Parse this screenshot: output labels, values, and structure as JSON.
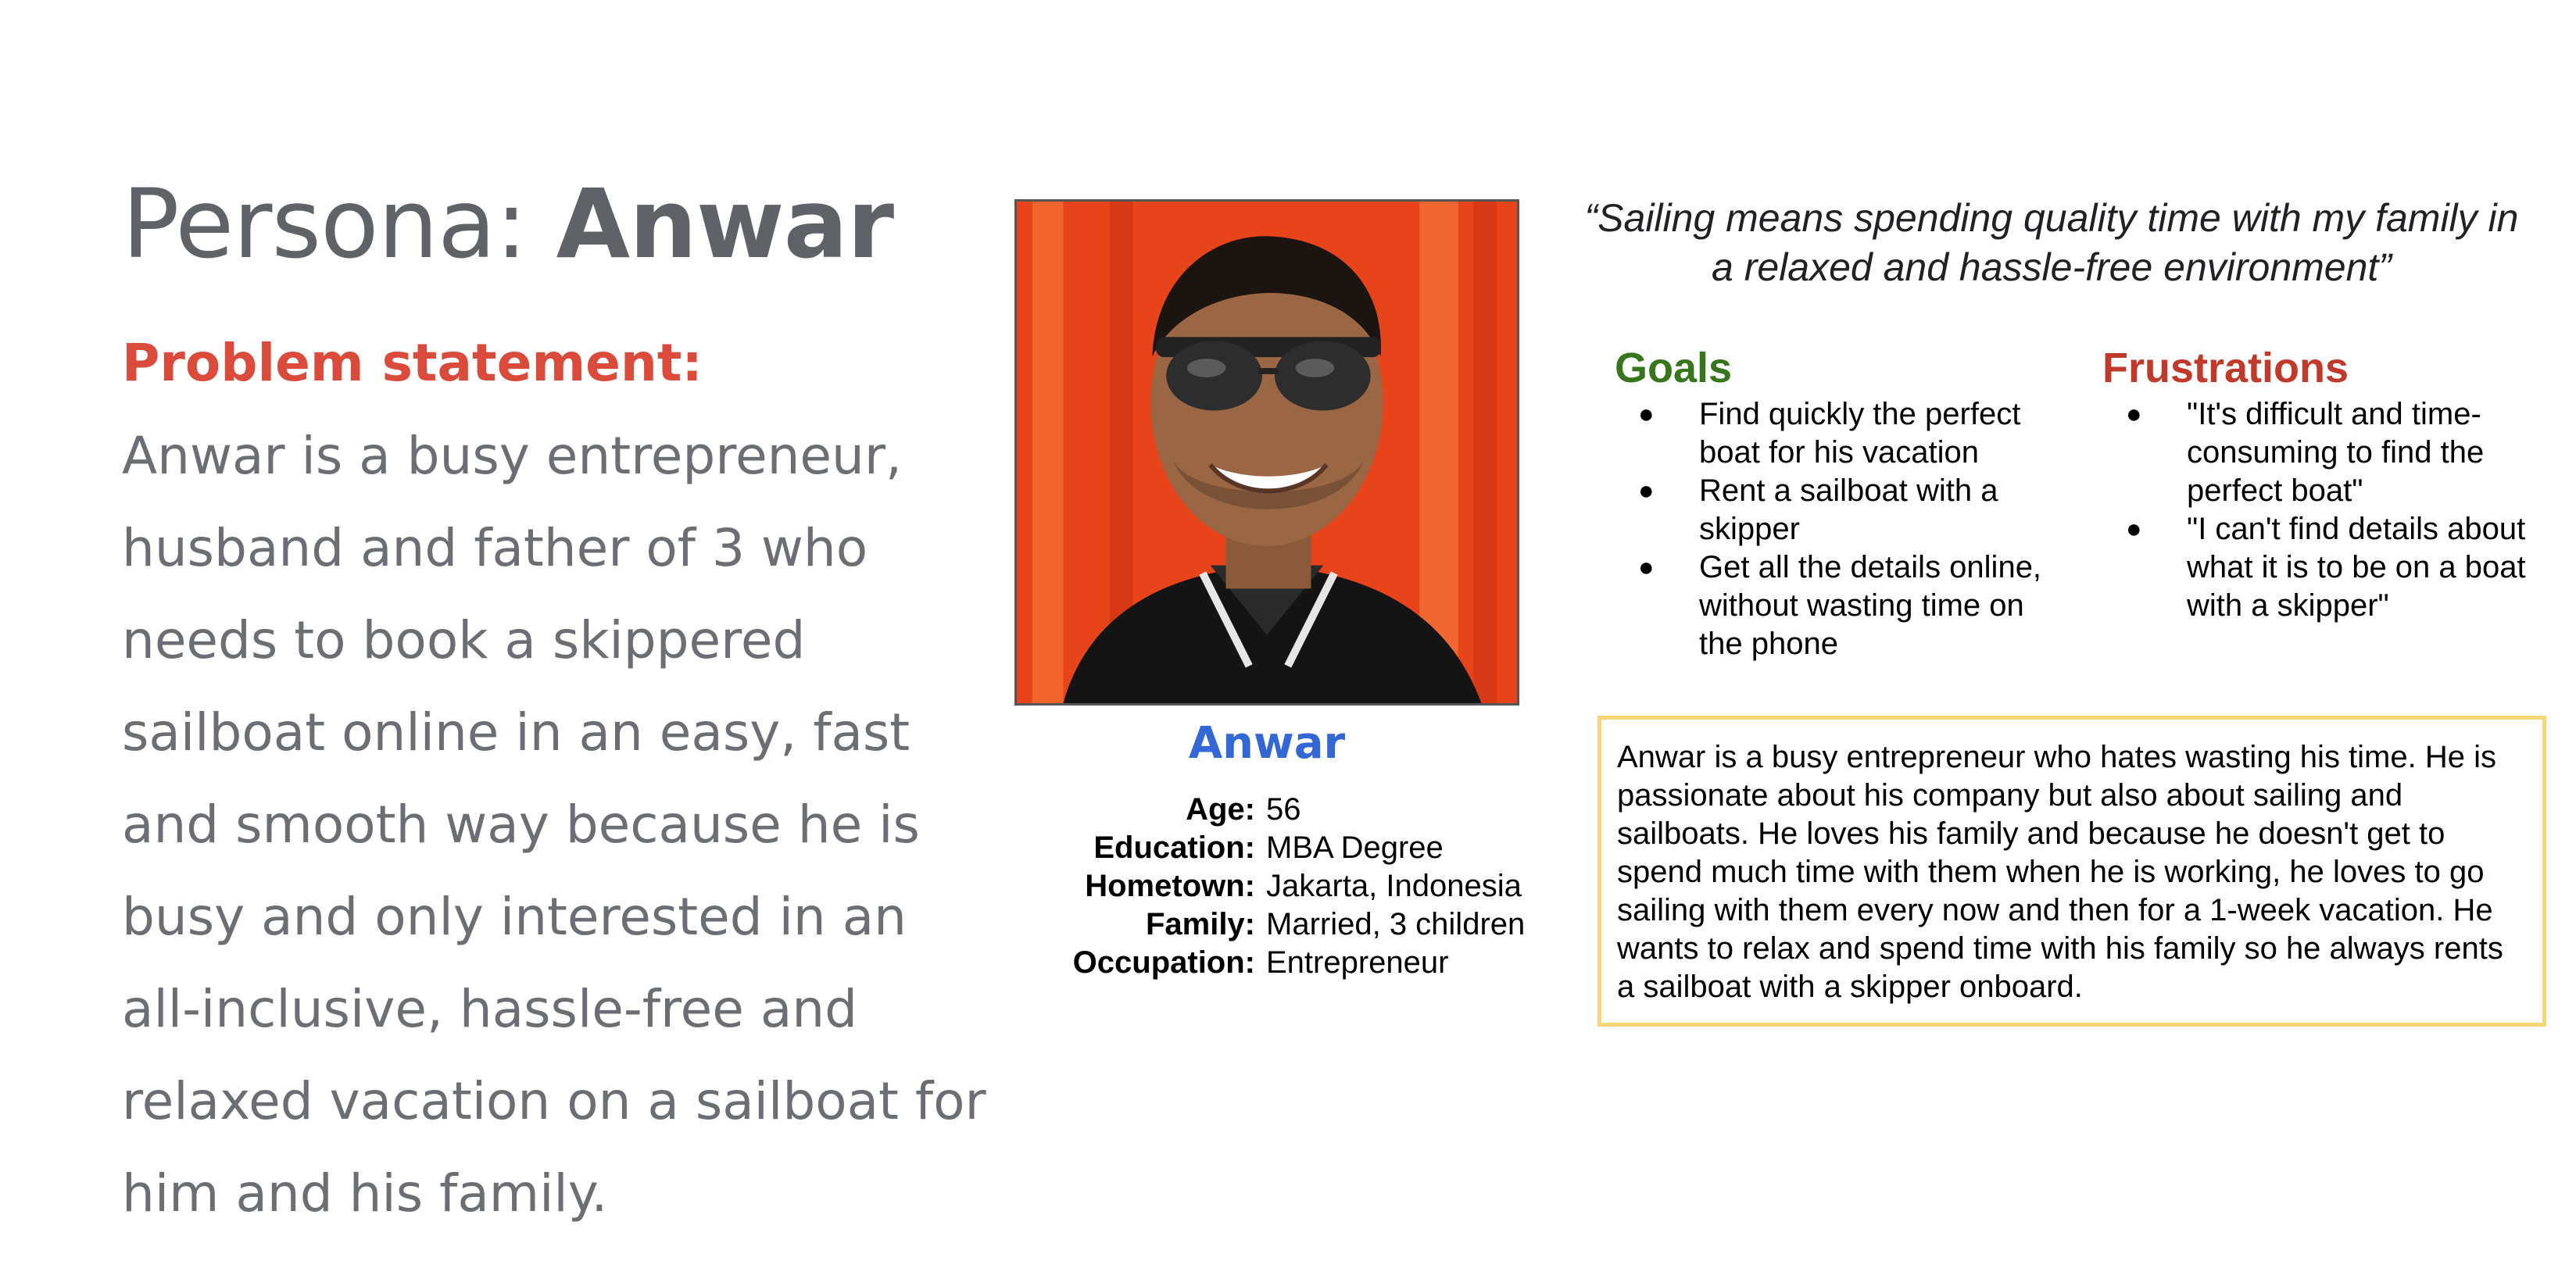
{
  "title": {
    "prefix": "Persona: ",
    "name": "Anwar"
  },
  "problem": {
    "heading": "Problem statement:",
    "text": "Anwar is a busy entrepreneur, husband and father of 3 who needs to book a skippered sailboat online in an easy, fast and smooth way because he is busy and only interested in an all-inclusive, hassle-free and relaxed vacation on a sailboat for him and his family."
  },
  "persona": {
    "name": "Anwar",
    "facts": [
      {
        "label": "Age:",
        "value": "56"
      },
      {
        "label": "Education:",
        "value": "MBA Degree"
      },
      {
        "label": "Hometown:",
        "value": "Jakarta, Indonesia"
      },
      {
        "label": "Family:",
        "value": "Married, 3 children"
      },
      {
        "label": "Occupation:",
        "value": "Entrepreneur"
      }
    ]
  },
  "quote": "“Sailing means spending quality time with my family in a relaxed and hassle-free environment”",
  "goals": {
    "heading": "Goals",
    "items": [
      "Find quickly the perfect boat for his vacation",
      "Rent a sailboat with a skipper",
      "Get all the details online, without wasting time on the phone"
    ]
  },
  "frustrations": {
    "heading": "Frustrations",
    "items": [
      "\"It's difficult and time-consuming to find the perfect boat\"",
      "\"I can't find details about what it is to be on a boat with a skipper\""
    ]
  },
  "bio": "Anwar is a busy entrepreneur who hates wasting his time. He is passionate about his company but also about sailing and sailboats. He loves his family and because he doesn't get to spend much time with them when he is working, he loves to go sailing with them every now and then for a 1-week vacation. He wants to relax and spend time with his family so he always rents a sailboat with a skipper onboard.",
  "bullet_glyph": "●",
  "colors": {
    "title": "#5f6368",
    "problem_heading": "#db4b3b",
    "persona_name": "#3367d6",
    "goals_heading": "#38761d",
    "frustrations_heading": "#c0392b",
    "bio_border": "#f7d774"
  }
}
